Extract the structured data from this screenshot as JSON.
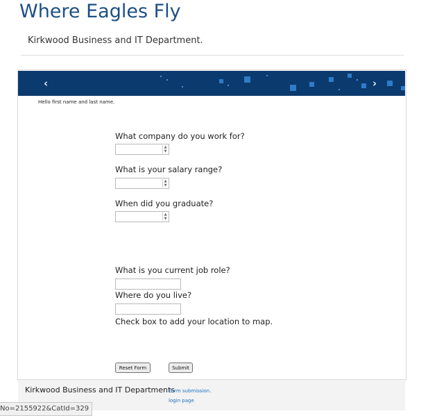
{
  "header": {
    "title": "Where Eagles Fly",
    "subtitle": "Kirkwood Business and IT Department."
  },
  "banner": {
    "prev_icon": "chevron-left-icon",
    "next_icon": "chevron-right-icon",
    "prev_glyph": "‹",
    "next_glyph": "›",
    "colors": {
      "background": "#0b3a6e",
      "squares": "#2f7bc8"
    }
  },
  "form": {
    "greeting": "Hello first name and last name.",
    "company_label": "What company do you work for?",
    "company_value": "",
    "salary_label": "What is your salary range?",
    "salary_value": "",
    "graduate_label": "When did you graduate?",
    "graduate_value": "",
    "job_role_label": "What is you current job role?",
    "job_role_value": "",
    "live_label": "Where do you live?",
    "live_value": "",
    "map_checkbox_label": "Check box to add your location to map.",
    "reset_label": "Reset Form",
    "submit_label": "Submit"
  },
  "footer": {
    "text": "Kirkwood Business and IT Departments",
    "form_link": "Form submission.",
    "login_link": "login page"
  },
  "status_bar": {
    "url_fragment": "No=2155922&CatId=329"
  }
}
